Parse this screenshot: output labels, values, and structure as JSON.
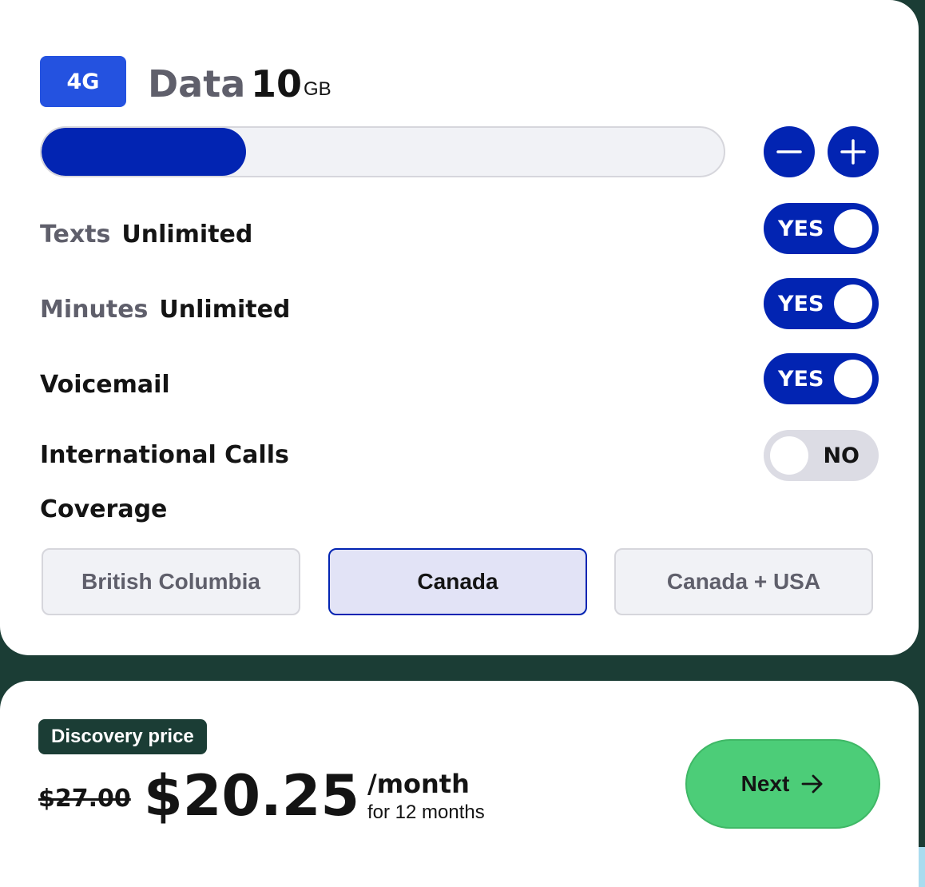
{
  "data_plan": {
    "network_badge": "4G",
    "data_label": "Data",
    "data_amount": "10",
    "data_unit": "GB",
    "slider_fill_percent": 30
  },
  "features": {
    "texts": {
      "label": "Texts",
      "value": "Unlimited",
      "toggle": "YES"
    },
    "minutes": {
      "label": "Minutes",
      "value": "Unlimited",
      "toggle": "YES"
    },
    "voicemail": {
      "label": "Voicemail",
      "toggle": "YES"
    },
    "international_calls": {
      "label": "International Calls",
      "toggle": "NO"
    }
  },
  "coverage": {
    "heading": "Coverage",
    "options": [
      "British Columbia",
      "Canada",
      "Canada + USA"
    ],
    "selected": "Canada"
  },
  "pricing": {
    "badge": "Discovery price",
    "old_price": "$27.00",
    "price": "$20.25",
    "period": "/month",
    "term": "for 12 months"
  },
  "actions": {
    "next_label": "Next"
  },
  "colors": {
    "accent": "#0224b2",
    "badge_blue": "#2452e0",
    "dark_green": "#1b3d35",
    "next_green": "#4ccd78"
  }
}
